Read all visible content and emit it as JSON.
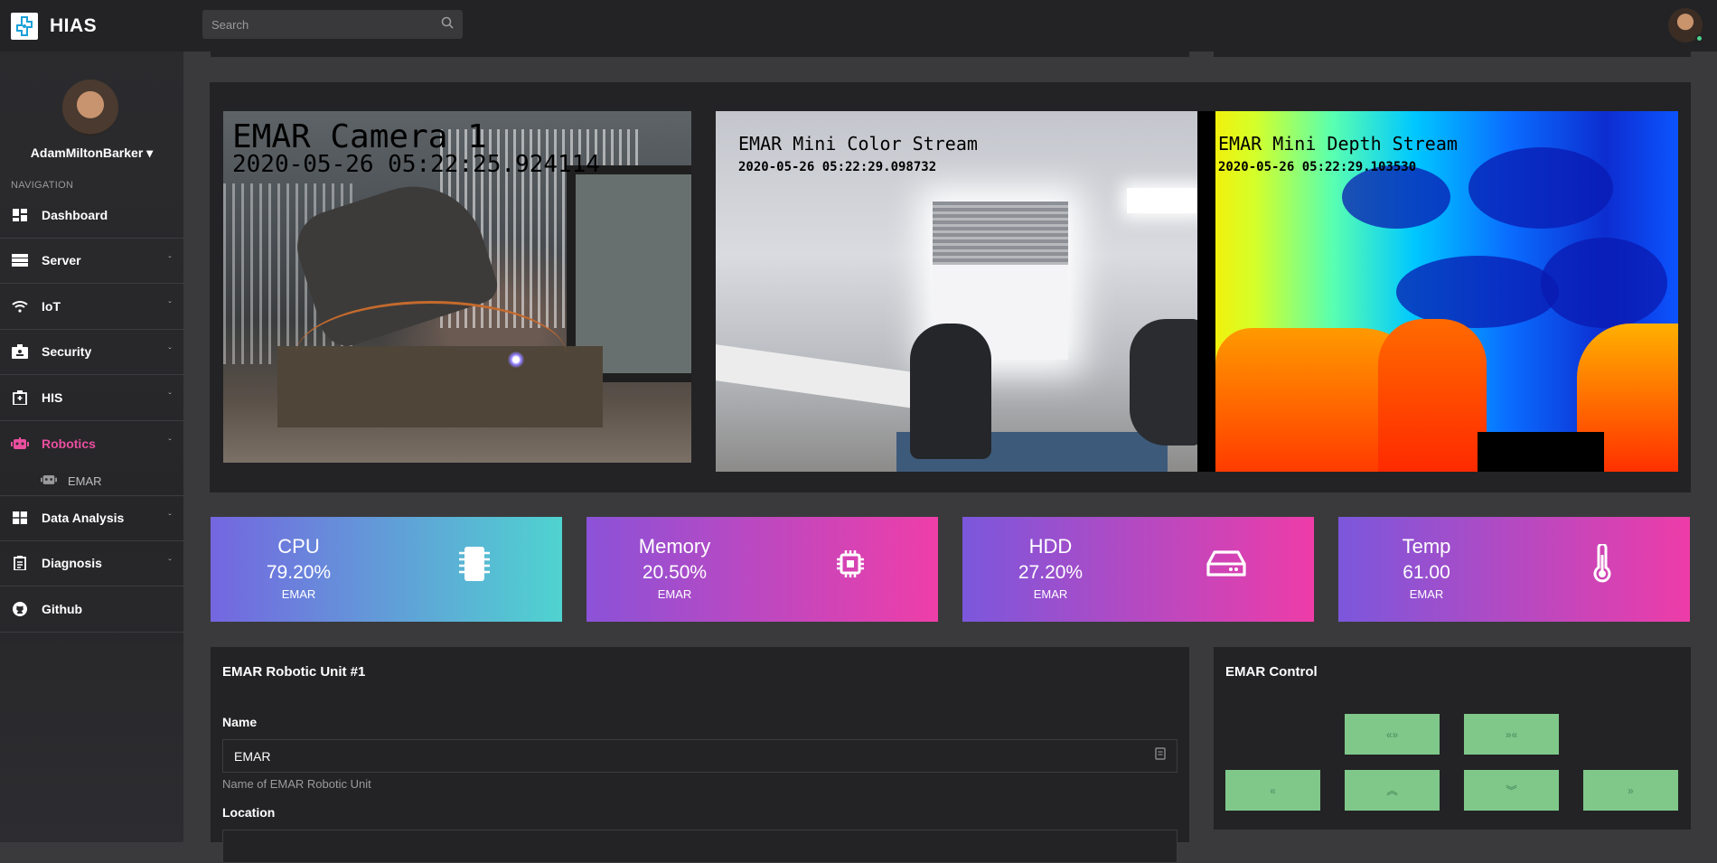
{
  "brand": {
    "name": "HIAS"
  },
  "search": {
    "placeholder": "Search"
  },
  "profile": {
    "name": "AdamMiltonBarker ▾"
  },
  "nav": {
    "heading": "NAVIGATION",
    "items": [
      {
        "label": "Dashboard",
        "icon": "dashboard-icon",
        "chevron": ""
      },
      {
        "label": "Server",
        "icon": "server-icon",
        "chevron": "ˇ"
      },
      {
        "label": "IoT",
        "icon": "wifi-icon",
        "chevron": "ˇ"
      },
      {
        "label": "Security",
        "icon": "id-badge-icon",
        "chevron": "ˇ"
      },
      {
        "label": "HIS",
        "icon": "hospital-icon",
        "chevron": "ˇ"
      },
      {
        "label": "Robotics",
        "icon": "robot-icon",
        "chevron": "ˇ",
        "active": true
      },
      {
        "label": "Data Analysis",
        "icon": "table-icon",
        "chevron": "ˇ"
      },
      {
        "label": "Diagnosis",
        "icon": "clipboard-icon",
        "chevron": "ˇ"
      },
      {
        "label": "Github",
        "icon": "github-icon",
        "chevron": ""
      }
    ],
    "sub_items": [
      {
        "label": "EMAR",
        "icon": "robot-icon"
      }
    ]
  },
  "cameras": {
    "cam1": {
      "title": "EMAR Camera 1",
      "timestamp": "2020-05-26 05:22:25.924114"
    },
    "cam2": {
      "title": "EMAR Mini Color Stream",
      "timestamp": "2020-05-26 05:22:29.098732"
    },
    "cam3": {
      "title": "EMAR Mini Depth Stream",
      "timestamp": "2020-05-26 05:22:29.103530"
    }
  },
  "stats": [
    {
      "name": "CPU",
      "value": "79.20%",
      "sub": "EMAR",
      "icon": "microchip-icon"
    },
    {
      "name": "Memory",
      "value": "20.50%",
      "sub": "EMAR",
      "icon": "memory-chip-icon"
    },
    {
      "name": "HDD",
      "value": "27.20%",
      "sub": "EMAR",
      "icon": "hard-drive-icon"
    },
    {
      "name": "Temp",
      "value": "61.00",
      "sub": "EMAR",
      "icon": "thermometer-icon"
    }
  ],
  "robot_form": {
    "title": "EMAR Robotic Unit #1",
    "name_label": "Name",
    "name_value": "EMAR",
    "name_help": "Name of EMAR Robotic Unit",
    "location_label": "Location"
  },
  "control": {
    "title": "EMAR Control",
    "buttons": {
      "open": "«»",
      "close": "»«",
      "left": "«",
      "up": "︽",
      "down": "︾",
      "right": "»"
    },
    "button_color": "#7fc88a"
  },
  "colors": {
    "accent": "#ea4f9f",
    "sidebar": "#2b2b2e",
    "card": "#232325"
  }
}
